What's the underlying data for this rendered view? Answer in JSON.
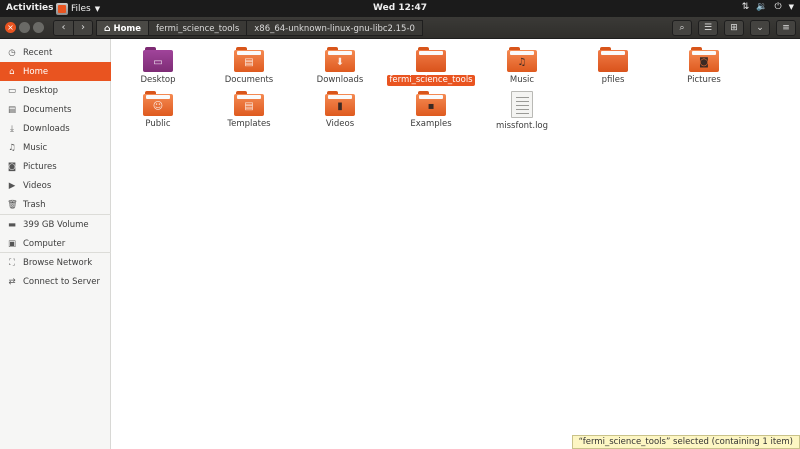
{
  "topbar": {
    "activities": "Activities",
    "app_name": "Files",
    "clock": "Wed 12:47"
  },
  "header": {
    "path": [
      {
        "label": "Home",
        "active": true
      },
      {
        "label": "fermi_science_tools",
        "active": false
      },
      {
        "label": "x86_64-unknown-linux-gnu-libc2.15-0",
        "active": false
      }
    ]
  },
  "sidebar": {
    "items": [
      {
        "label": "Recent",
        "icon": "clock-icon",
        "active": false
      },
      {
        "label": "Home",
        "icon": "home-icon",
        "active": true
      },
      {
        "label": "Desktop",
        "icon": "desktop-icon",
        "active": false
      },
      {
        "label": "Documents",
        "icon": "documents-icon",
        "active": false
      },
      {
        "label": "Downloads",
        "icon": "download-icon",
        "active": false
      },
      {
        "label": "Music",
        "icon": "music-icon",
        "active": false
      },
      {
        "label": "Pictures",
        "icon": "camera-icon",
        "active": false
      },
      {
        "label": "Videos",
        "icon": "video-icon",
        "active": false
      },
      {
        "label": "Trash",
        "icon": "trash-icon",
        "active": false
      },
      {
        "label": "399 GB Volume",
        "icon": "drive-icon",
        "active": false
      },
      {
        "label": "Computer",
        "icon": "computer-icon",
        "active": false
      },
      {
        "label": "Browse Network",
        "icon": "network-icon",
        "active": false
      },
      {
        "label": "Connect to Server",
        "icon": "server-icon",
        "active": false
      }
    ]
  },
  "files": [
    {
      "name": "Desktop",
      "kind": "folder-desktop",
      "selected": false
    },
    {
      "name": "Documents",
      "kind": "folder-documents",
      "selected": false
    },
    {
      "name": "Downloads",
      "kind": "folder-downloads",
      "selected": false
    },
    {
      "name": "fermi_science_tools",
      "kind": "folder",
      "selected": true
    },
    {
      "name": "Music",
      "kind": "folder-music",
      "selected": false
    },
    {
      "name": "pfiles",
      "kind": "folder",
      "selected": false
    },
    {
      "name": "Pictures",
      "kind": "folder-pictures",
      "selected": false
    },
    {
      "name": "Public",
      "kind": "folder-public",
      "selected": false
    },
    {
      "name": "Templates",
      "kind": "folder-templates",
      "selected": false
    },
    {
      "name": "Videos",
      "kind": "folder-videos",
      "selected": false
    },
    {
      "name": "Examples",
      "kind": "folder-examples",
      "selected": false
    },
    {
      "name": "missfont.log",
      "kind": "text-file",
      "selected": false
    }
  ],
  "status": "“fermi_science_tools” selected (containing 1 item)",
  "colors": {
    "accent": "#e95420",
    "panel": "#1b1b1b",
    "sidebar": "#f6f6f5"
  }
}
